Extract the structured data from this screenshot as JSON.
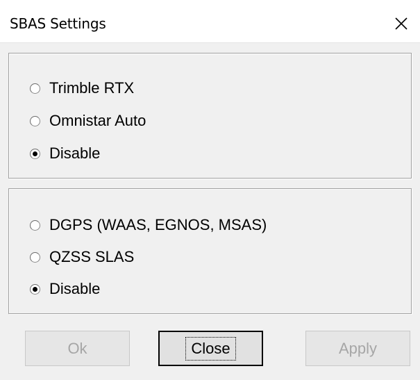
{
  "window": {
    "title": "SBAS Settings"
  },
  "group1": {
    "options": [
      {
        "label": "Trimble RTX",
        "checked": false
      },
      {
        "label": "Omnistar Auto",
        "checked": false
      },
      {
        "label": "Disable",
        "checked": true
      }
    ]
  },
  "group2": {
    "options": [
      {
        "label": "DGPS (WAAS, EGNOS, MSAS)",
        "checked": false
      },
      {
        "label": "QZSS SLAS",
        "checked": false
      },
      {
        "label": "Disable",
        "checked": true
      }
    ]
  },
  "buttons": {
    "ok": {
      "label": "Ok",
      "enabled": false
    },
    "close": {
      "label": "Close",
      "enabled": true,
      "default": true
    },
    "apply": {
      "label": "Apply",
      "enabled": false
    }
  },
  "icons": {
    "close": "close-icon"
  }
}
